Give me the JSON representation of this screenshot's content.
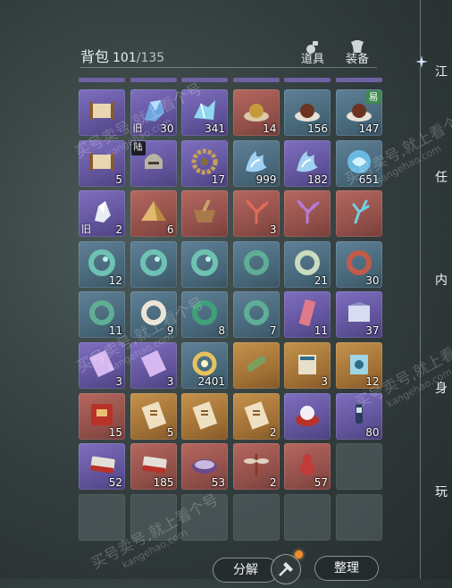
{
  "header": {
    "title": "背包",
    "count": "101",
    "max": "/135"
  },
  "tabs": [
    {
      "label": "道具"
    },
    {
      "label": "装备"
    }
  ],
  "side_menu": [
    "江",
    "任",
    "内",
    "身",
    "玩"
  ],
  "buttons": {
    "disassemble": "分解",
    "sort": "整理"
  },
  "watermark": {
    "line1": "买号卖号,就上看个号",
    "line2": "kangehao.com"
  },
  "badges": {
    "trade": "易",
    "land": "陆",
    "old": "旧"
  },
  "colors": {
    "purple": "#6f5fae",
    "blue": "#4f6f84",
    "red": "#9a5650",
    "gold": "#a8773a",
    "accent": "#f08a2a"
  },
  "cells": [
    {
      "r": "purple",
      "icon": "scroll-icon",
      "qty": ""
    },
    {
      "r": "purple",
      "icon": "blue-fragment-icon",
      "qty": "30",
      "old": true
    },
    {
      "r": "purple",
      "icon": "crystal-fragment-icon",
      "qty": "341"
    },
    {
      "r": "red",
      "icon": "gold-orb-icon",
      "qty": "14"
    },
    {
      "r": "blue",
      "icon": "brown-orb-icon",
      "qty": "156"
    },
    {
      "r": "blue",
      "icon": "brown-orb-icon",
      "qty": "147",
      "trade": true
    },
    {
      "r": "purple",
      "icon": "scroll-icon",
      "qty": "5"
    },
    {
      "r": "purple",
      "icon": "helmet-icon",
      "qty": "",
      "land": true
    },
    {
      "r": "purple",
      "icon": "gear-ring-icon",
      "qty": "17"
    },
    {
      "r": "blue",
      "icon": "water-spirit-icon",
      "qty": "999"
    },
    {
      "r": "purple",
      "icon": "water-spirit-icon",
      "qty": "182"
    },
    {
      "r": "blue",
      "icon": "swirl-icon",
      "qty": "651"
    },
    {
      "r": "purple",
      "icon": "white-stone-icon",
      "qty": "2",
      "old": true
    },
    {
      "r": "red",
      "icon": "pyramid-icon",
      "qty": "6"
    },
    {
      "r": "red",
      "icon": "mortar-icon",
      "qty": ""
    },
    {
      "r": "red",
      "icon": "coral-icon",
      "qty": "3"
    },
    {
      "r": "red",
      "icon": "purple-coral-icon",
      "qty": ""
    },
    {
      "r": "red",
      "icon": "blue-coral-icon",
      "qty": ""
    },
    {
      "r": "blue",
      "icon": "jade-swirl-icon",
      "qty": "12"
    },
    {
      "r": "blue",
      "icon": "jade-swirl-icon",
      "qty": ""
    },
    {
      "r": "blue",
      "icon": "jade-swirl-icon",
      "qty": ""
    },
    {
      "r": "blue",
      "icon": "jade-bracelet-icon",
      "qty": ""
    },
    {
      "r": "blue",
      "icon": "pale-bracelet-icon",
      "qty": "21"
    },
    {
      "r": "blue",
      "icon": "red-bracelet-icon",
      "qty": "30"
    },
    {
      "r": "blue",
      "icon": "jade-bracelet-icon",
      "qty": "11"
    },
    {
      "r": "blue",
      "icon": "white-bracelet-icon",
      "qty": "9"
    },
    {
      "r": "blue",
      "icon": "green-bracelet-icon",
      "qty": "8"
    },
    {
      "r": "blue",
      "icon": "jade-bracelet-icon",
      "qty": "7"
    },
    {
      "r": "purple",
      "icon": "red-talisman-icon",
      "qty": "11"
    },
    {
      "r": "purple",
      "icon": "book-icon",
      "qty": "37"
    },
    {
      "r": "purple",
      "icon": "purple-scroll-icon",
      "qty": "3"
    },
    {
      "r": "purple",
      "icon": "purple-scroll-icon",
      "qty": "3"
    },
    {
      "r": "blue",
      "icon": "gold-ring-icon",
      "qty": "2401"
    },
    {
      "r": "gold",
      "icon": "green-scroll-icon",
      "qty": ""
    },
    {
      "r": "gold",
      "icon": "manual-icon",
      "qty": "3"
    },
    {
      "r": "gold",
      "icon": "blue-manual-icon",
      "qty": "12"
    },
    {
      "r": "red",
      "icon": "red-envelope-icon",
      "qty": "15"
    },
    {
      "r": "gold",
      "icon": "paper-scroll-icon",
      "qty": "5"
    },
    {
      "r": "gold",
      "icon": "paper-scroll-icon",
      "qty": ""
    },
    {
      "r": "gold",
      "icon": "paper-scroll-icon",
      "qty": "2"
    },
    {
      "r": "purple",
      "icon": "pearl-cushion-icon",
      "qty": ""
    },
    {
      "r": "purple",
      "icon": "lantern-icon",
      "qty": "80"
    },
    {
      "r": "purple",
      "icon": "cloth-bundle-icon",
      "qty": "52"
    },
    {
      "r": "red",
      "icon": "cloth-bundle-icon",
      "qty": "185"
    },
    {
      "r": "red",
      "icon": "bowl-icon",
      "qty": "53"
    },
    {
      "r": "red",
      "icon": "dragonfly-icon",
      "qty": "2"
    },
    {
      "r": "red",
      "icon": "red-gourd-icon",
      "qty": "57"
    },
    {
      "r": "empty",
      "icon": "",
      "qty": ""
    },
    {
      "r": "empty",
      "icon": "",
      "qty": ""
    },
    {
      "r": "empty",
      "icon": "",
      "qty": ""
    },
    {
      "r": "empty",
      "icon": "",
      "qty": ""
    },
    {
      "r": "empty",
      "icon": "",
      "qty": ""
    },
    {
      "r": "empty",
      "icon": "",
      "qty": ""
    },
    {
      "r": "empty",
      "icon": "",
      "qty": ""
    }
  ]
}
